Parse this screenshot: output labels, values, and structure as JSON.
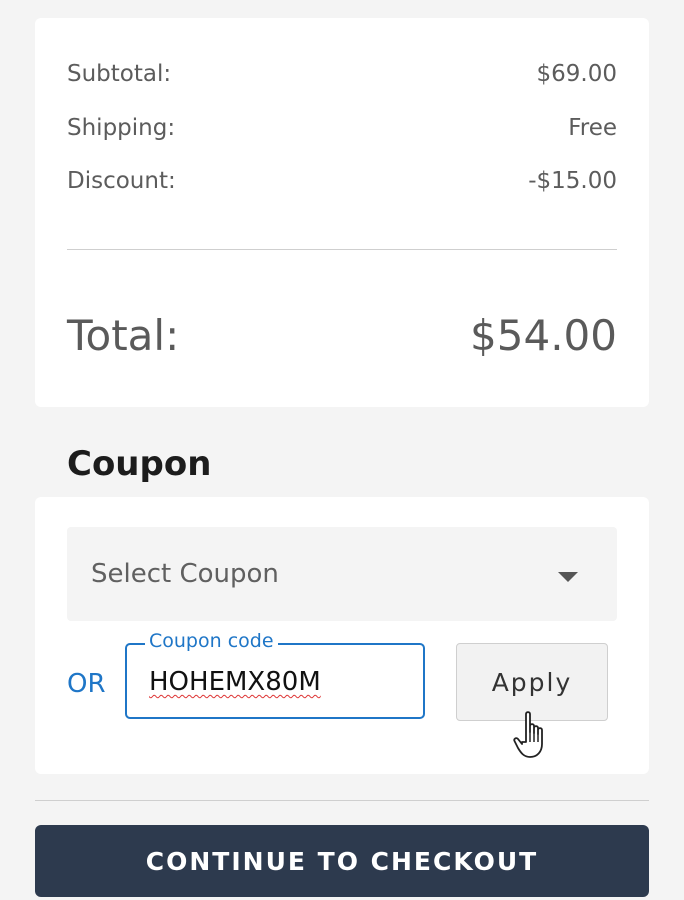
{
  "summary": {
    "subtotal_label": "Subtotal:",
    "subtotal_value": "$69.00",
    "shipping_label": "Shipping:",
    "shipping_value": "Free",
    "discount_label": "Discount:",
    "discount_value": "-$15.00",
    "total_label": "Total:",
    "total_value": "$54.00"
  },
  "coupon": {
    "heading": "Coupon",
    "select_value": "Select Coupon",
    "or_label": "OR",
    "code_legend": "Coupon code",
    "code_value": "HOHEMX80M",
    "apply_label": "Apply"
  },
  "checkout": {
    "button_label": "CONTINUE TO CHECKOUT"
  },
  "colors": {
    "accent": "#1f76c7",
    "checkout_bg": "#2d3a4e"
  },
  "icons": {
    "dropdown": "chevron-down-icon",
    "cursor": "hand-pointer-icon"
  }
}
